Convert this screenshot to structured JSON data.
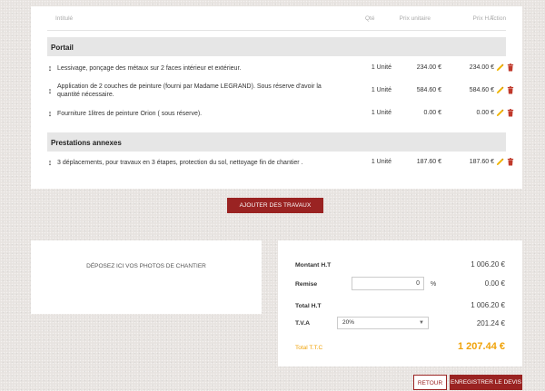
{
  "table": {
    "headers": {
      "intitule": "Intitulé",
      "qte": "Qté",
      "prix_unitaire": "Prix unitaire",
      "prix_ht": "Prix H.T",
      "action": "Action"
    },
    "sections": [
      {
        "title": "Portail",
        "rows": [
          {
            "desc": "Lessivage, ponçage des métaux sur 2 faces intérieur et extérieur.",
            "qty": "1 Unité",
            "unit_price": "234.00 €",
            "total": "234.00 €"
          },
          {
            "desc": "Application de 2 couches de peinture (fourni par Madame LEGRAND). Sous réserve d'avoir la quantité nécessaire.",
            "qty": "1 Unité",
            "unit_price": "584.60 €",
            "total": "584.60 €"
          },
          {
            "desc": "Fourniture 1litres de peinture Orion ( sous réserve).",
            "qty": "1 Unité",
            "unit_price": "0.00 €",
            "total": "0.00 €"
          }
        ]
      },
      {
        "title": "Prestations annexes",
        "rows": [
          {
            "desc": "3 déplacements, pour travaux en 3 étapes, protection du sol, nettoyage fin de chantier .",
            "qty": "1 Unité",
            "unit_price": "187.60 €",
            "total": "187.60 €"
          }
        ]
      }
    ]
  },
  "add_button": "AJOUTER DES TRAVAUX",
  "photos": {
    "drop_text": "DÉPOSEZ ICI VOS PHOTOS DE CHANTIER"
  },
  "totals": {
    "montant_ht_label": "Montant H.T",
    "montant_ht": "1 006.20 €",
    "remise_label": "Remise",
    "remise_value": "0",
    "remise_unit": "%",
    "remise_amount": "0.00 €",
    "total_ht_label": "Total H.T",
    "total_ht": "1 006.20 €",
    "tva_label": "T.V.A",
    "tva_selected": "20%",
    "tva_amount": "201.24 €",
    "total_ttc_label": "Total T.T.C",
    "total_ttc": "1 207.44 €"
  },
  "buttons": {
    "retour": "RETOUR",
    "save": "ENREGISTRER LE DEVIS"
  },
  "colors": {
    "accent": "#9a2322",
    "ttc": "#f0a30a",
    "edit_icon": "#f0b400",
    "delete_icon": "#c0392b"
  }
}
